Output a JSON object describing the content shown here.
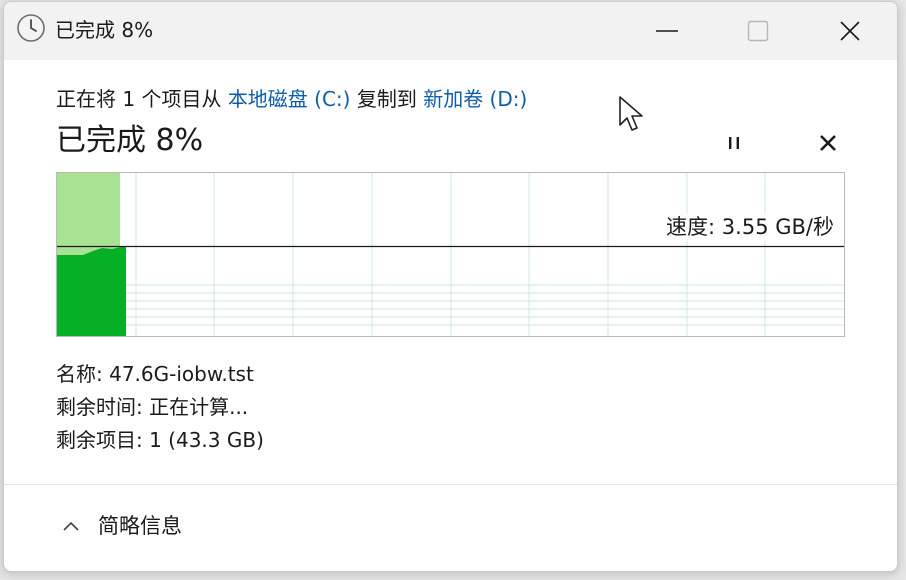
{
  "window": {
    "title": "已完成 8%",
    "icon": "clock-icon",
    "controls": [
      "minimize-icon",
      "maximize-icon",
      "close-icon"
    ]
  },
  "operation": {
    "prefix": "正在将 1 个项目从",
    "source": "本地磁盘 (C:)",
    "middle": "复制到",
    "destination": "新加卷 (D:)"
  },
  "status": {
    "completed": "已完成 8%",
    "progress_percent": 8
  },
  "buttons": {
    "pause_icon": "pause-icon",
    "cancel_icon": "cancel-icon"
  },
  "speed": {
    "label": "速度: 3.55 GB/秒"
  },
  "details": {
    "name": "名称: 47.6G-iobw.tst",
    "time_remaining": "剩余时间: 正在计算...",
    "items_remaining": "剩余项目: 1 (43.3 GB)"
  },
  "footer": {
    "toggle_label": "简略信息",
    "toggle_icon": "chevron-up-icon"
  },
  "colors": {
    "link": "#0e5ea8",
    "progress_fill": "#a8e293",
    "speed_fill": "#06b025",
    "grid": "#cfe8d8"
  }
}
